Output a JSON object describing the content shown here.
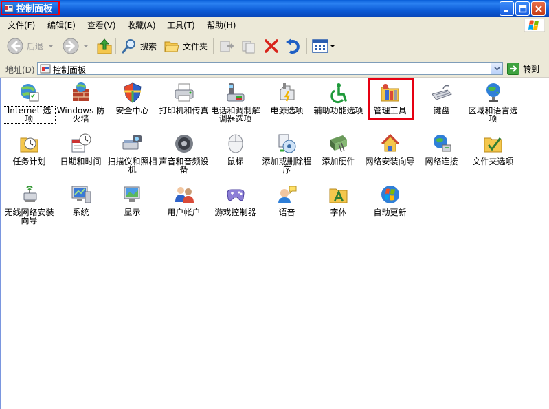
{
  "window": {
    "title": "控制面板"
  },
  "menu": [
    "文件(F)",
    "编辑(E)",
    "查看(V)",
    "收藏(A)",
    "工具(T)",
    "帮助(H)"
  ],
  "toolbar": {
    "back": "后退",
    "search": "搜索",
    "folders": "文件夹"
  },
  "address": {
    "label": "地址(D)",
    "value": "控制面板",
    "go": "转到"
  },
  "items": [
    "Internet 选项",
    "Windows 防火墙",
    "安全中心",
    "打印机和传真",
    "电话和调制解调器选项",
    "电源选项",
    "辅助功能选项",
    "管理工具",
    "键盘",
    "区域和语言选项",
    "任务计划",
    "日期和时间",
    "扫描仪和照相机",
    "声音和音频设备",
    "鼠标",
    "添加或删除程序",
    "添加硬件",
    "网络安装向导",
    "网络连接",
    "文件夹选项",
    "无线网络安装向导",
    "系统",
    "显示",
    "用户帐户",
    "游戏控制器",
    "语音",
    "字体",
    "自动更新"
  ],
  "highlighted_item": "管理工具",
  "colors": {
    "title_bar": "#0a5fd8",
    "highlight": "#e60012",
    "content_bg": "#ffffff"
  }
}
